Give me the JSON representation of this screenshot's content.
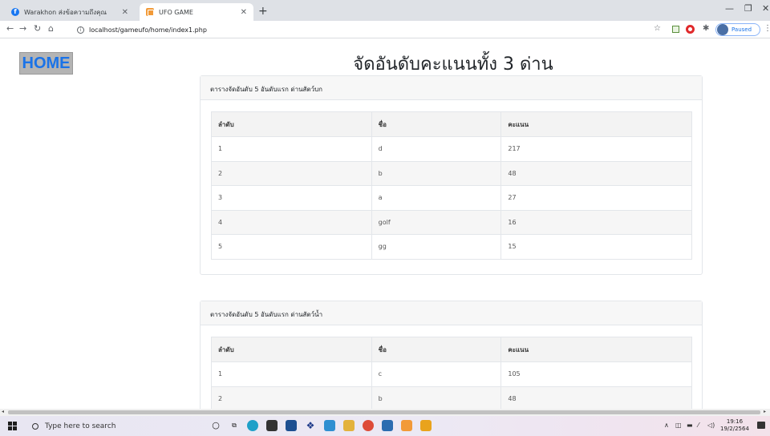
{
  "browser": {
    "tabs": [
      {
        "title": "Warakhon ส่งข้อความถึงคุณ",
        "icon": "facebook-icon",
        "active": false
      },
      {
        "title": "UFO GAME",
        "icon": "ufo-game-icon",
        "active": true
      }
    ],
    "new_tab": "+",
    "address": "localhost/gameufo/home/index1.php",
    "profile_status": "Paused"
  },
  "page": {
    "home_label": "HOME",
    "title": "จัดอันดับคะแนนทั้ง 3 ด่าน",
    "tables": [
      {
        "caption": "ตารางจัดอันดับ 5 อันดับแรก ด่านสัตว์บก",
        "headers": [
          "ลำดับ",
          "ชื่อ",
          "คะแนน"
        ],
        "rows": [
          [
            "1",
            "d",
            "217"
          ],
          [
            "2",
            "b",
            "48"
          ],
          [
            "3",
            "a",
            "27"
          ],
          [
            "4",
            "golf",
            "16"
          ],
          [
            "5",
            "gg",
            "15"
          ]
        ]
      },
      {
        "caption": "ตารางจัดอันดับ 5 อันดับแรก ด่านสัตว์น้ำ",
        "headers": [
          "ลำดับ",
          "ชื่อ",
          "คะแนน"
        ],
        "rows": [
          [
            "1",
            "c",
            "105"
          ],
          [
            "2",
            "b",
            "48"
          ]
        ]
      }
    ]
  },
  "taskbar": {
    "search_placeholder": "Type here to search",
    "time": "19:16",
    "date": "19/2/2564"
  }
}
